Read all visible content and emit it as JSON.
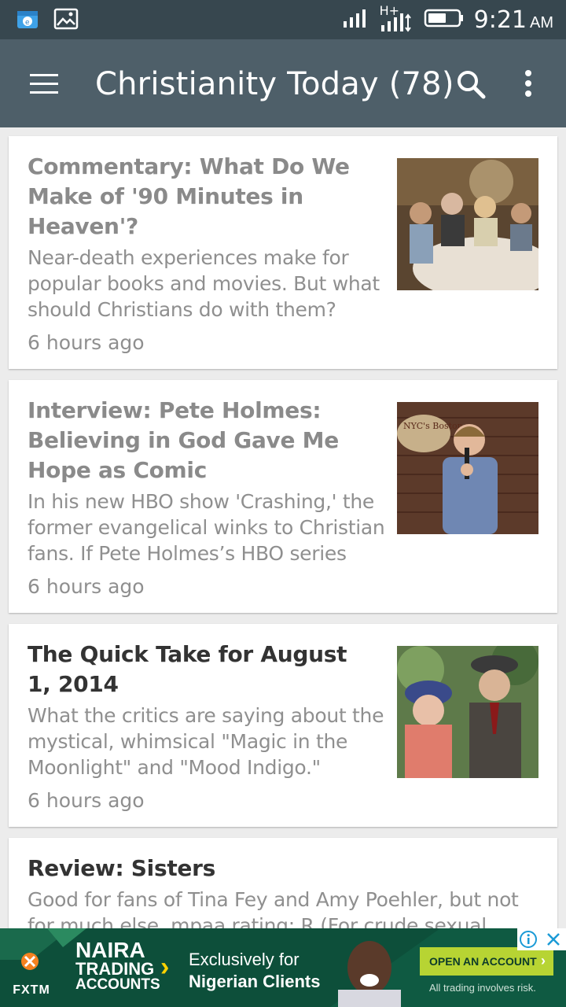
{
  "status_bar": {
    "time": "9:21",
    "ampm": "AM",
    "network": "H+",
    "icons": [
      "cloud-app-icon",
      "gallery-icon",
      "signal-icon",
      "network-hplus-icon",
      "battery-icon"
    ]
  },
  "app_bar": {
    "title": "Christianity Today (78)",
    "icons": [
      "menu-icon",
      "search-icon",
      "more-vert-icon"
    ]
  },
  "articles": [
    {
      "headline": "Commentary: What Do We Make of '90 Minutes in Heaven'?",
      "summary": "Near-death experiences make for popular books and movies. But what should Christians do with them?",
      "time": "6 hours ago",
      "read": true
    },
    {
      "headline": "Interview: Pete Holmes: Believing in God Gave Me Hope as Comic",
      "summary": "In his new HBO show 'Crashing,' the former evangelical winks to Christian fans. If Pete Holmes’s HBO series",
      "time": "6 hours ago",
      "read": true,
      "image_text": "NYC's Boston"
    },
    {
      "headline": "The Quick Take for August 1, 2014",
      "summary": "What the critics are saying about the mystical, whimsical \"Magic in the Moonlight\" and \"Mood Indigo.\"",
      "time": "6 hours ago",
      "read": false
    },
    {
      "headline": "Review: Sisters",
      "summary": "Good for fans of Tina Fey and Amy Poehler, but not for much else. mpaa rating: R (For crude sexual",
      "read": false
    }
  ],
  "ad": {
    "brand": "FXTM",
    "headline_1": "NAIRA",
    "headline_2": "TRADING",
    "headline_3": "ACCOUNTS",
    "tagline_1": "Exclusively for",
    "tagline_2": "Nigerian Clients",
    "cta": "OPEN AN ACCOUNT",
    "disclaimer": "All trading involves risk.",
    "colors": {
      "background": "#0d4f3a",
      "cta": "#b7d433",
      "accent": "#ffd200",
      "logo": "#f5821f"
    }
  },
  "colors": {
    "status_bar": "#37474f",
    "app_bar": "#4e5f69",
    "background": "#ececec",
    "read_headline": "#8a8a8a",
    "unread_headline": "#333333"
  }
}
